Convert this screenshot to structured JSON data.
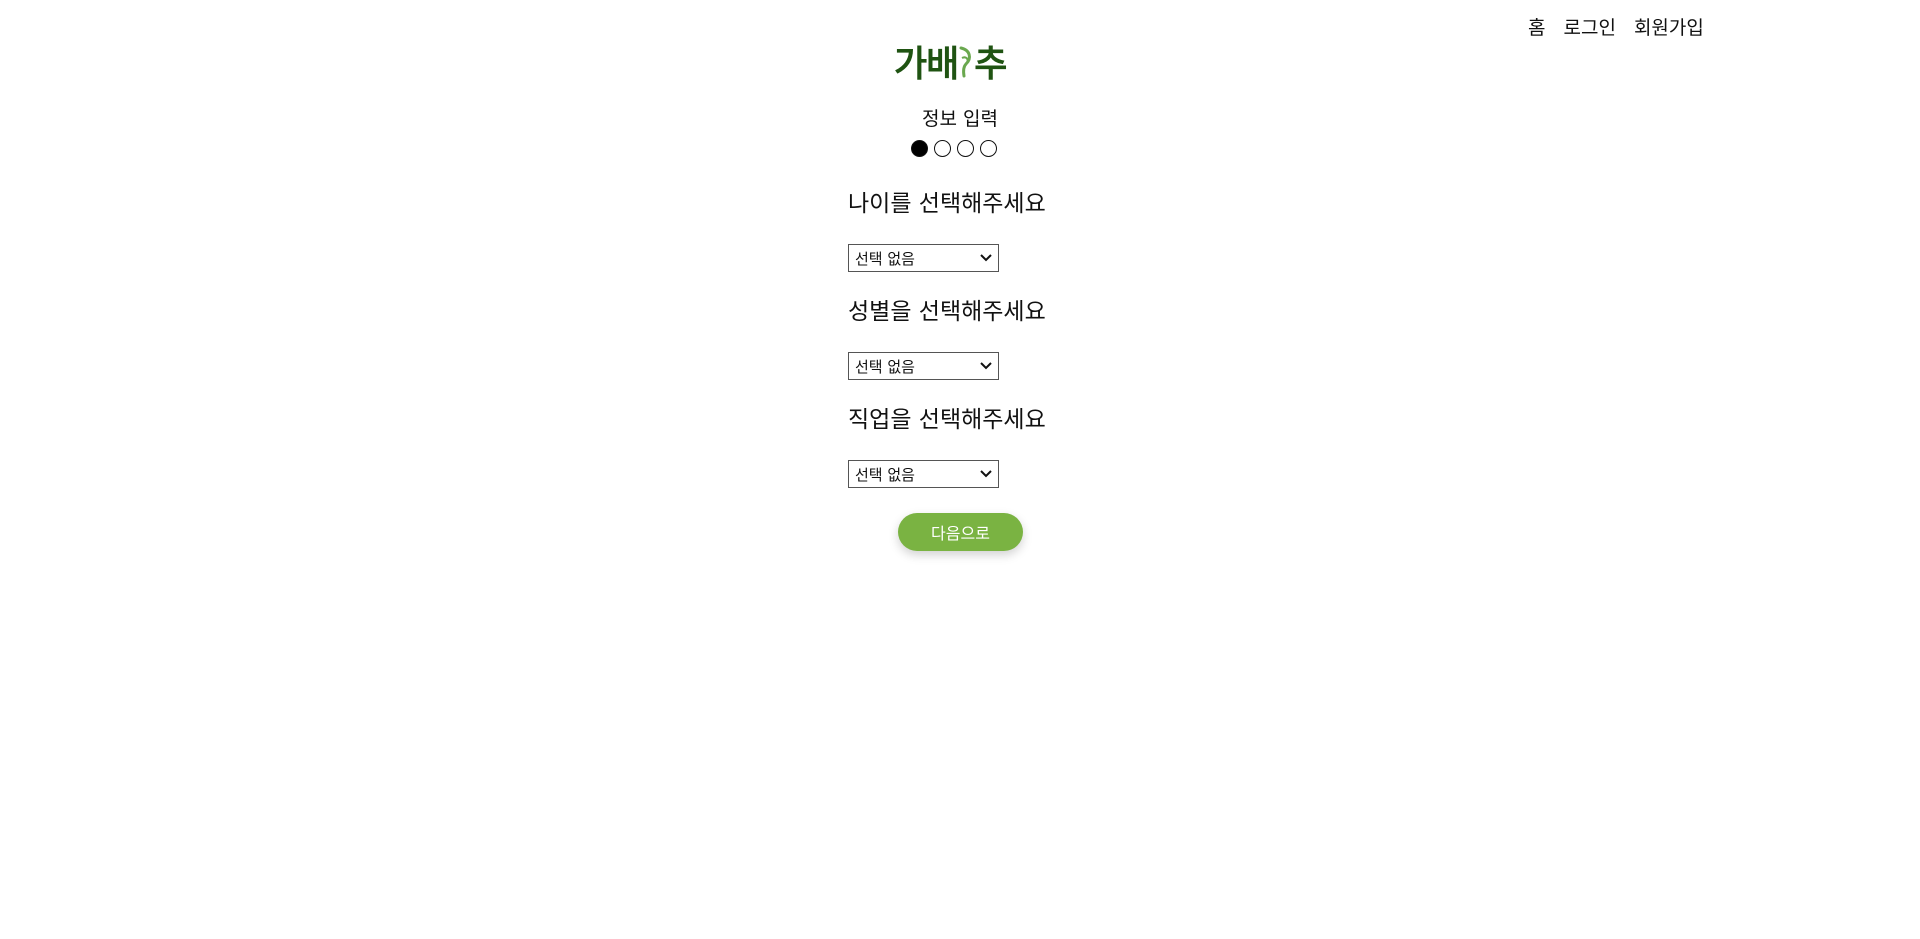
{
  "nav": {
    "home": "홈",
    "login": "로그인",
    "signup": "회원가입"
  },
  "logo": {
    "text_left": "가배",
    "text_right": "추",
    "text_color": "#1f5312",
    "accent_color": "#6aa84f"
  },
  "progress": {
    "title": "정보 입력",
    "total_steps": 4,
    "current_step": 1
  },
  "form": {
    "age": {
      "label": "나이를 선택해주세요",
      "selected": "선택 없음"
    },
    "gender": {
      "label": "성별을 선택해주세요",
      "selected": "선택 없음"
    },
    "job": {
      "label": "직업을 선택해주세요",
      "selected": "선택 없음"
    }
  },
  "next_button": {
    "label": "다음으로",
    "color": "#7ab342"
  }
}
